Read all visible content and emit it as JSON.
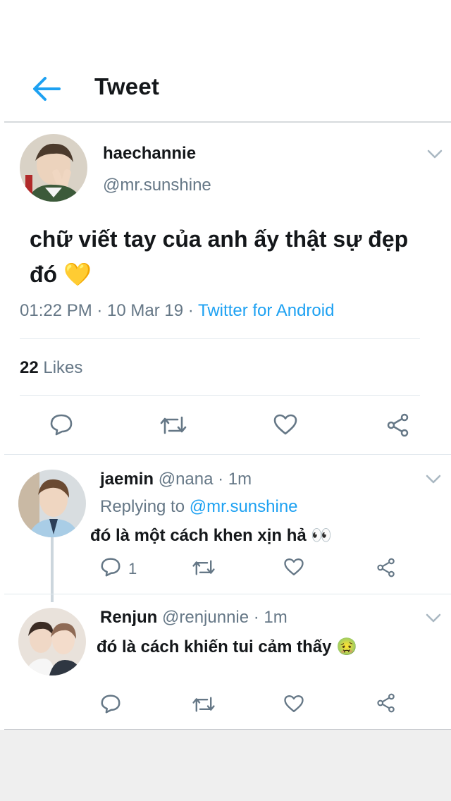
{
  "header": {
    "title": "Tweet"
  },
  "tweet": {
    "display_name": "haechannie",
    "handle": "@mr.sunshine",
    "text": "chữ viết tay của anh ấy thật sự đẹp đó 💛",
    "time": "01:22 PM · 10 Mar 19 · ",
    "source": "Twitter for Android",
    "likes_count": "22",
    "likes_label": "Likes"
  },
  "replies": [
    {
      "display_name": "jaemin",
      "meta": "@nana · 1m",
      "replying_label": "Replying to ",
      "replying_handle": "@mr.sunshine",
      "text": "đó là một cách khen xịn hả 👀",
      "reply_count": "1"
    },
    {
      "display_name": "Renjun",
      "meta": "@renjunnie · 1m",
      "text": "đó là cách khiến tui cảm thấy 🤢"
    }
  ],
  "colors": {
    "accent": "#1da1f2",
    "secondary_text": "#657786",
    "icon": "#657786"
  }
}
